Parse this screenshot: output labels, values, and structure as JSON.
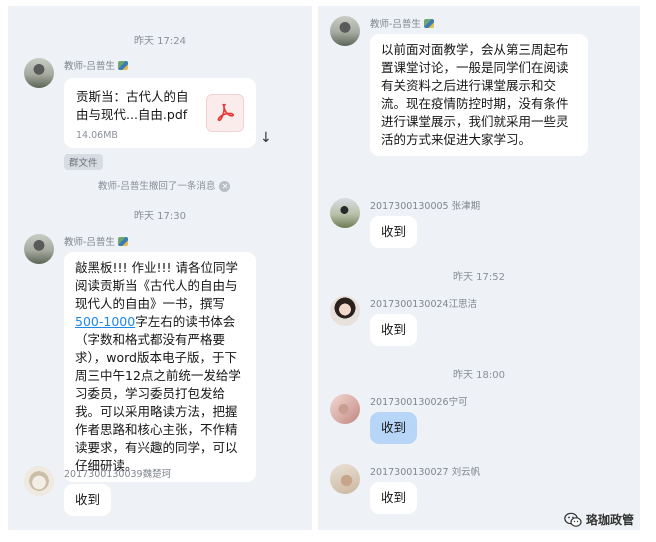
{
  "left": {
    "time1": "昨天 17:24",
    "file_msg": {
      "sender": "教师-吕普生",
      "file_name": "贡斯当：古代人的自由与现代...自由.pdf",
      "file_size": "14.06MB",
      "origin_chip": "群文件"
    },
    "recall_note": "教师-吕普生撤回了一条消息",
    "time2": "昨天 17:30",
    "assign_msg": {
      "sender": "教师-吕普生",
      "part1": "敲黑板!!! 作业!!! 请各位同学阅读贡斯当《古代人的自由与现代人的自由》一书，撰写",
      "link": "500-1000",
      "part2": "字左右的读书体会（字数和格式都没有严格要求），word版本电子版，于下周三中午12点之前统一发给学习委员，学习委员打包发给我。可以采用略读方法，把握作者思路和核心主张，不作精读要求，有兴趣的同学，可以仔细研读。"
    },
    "reply1": {
      "sender": "2017300130039魏楚珂",
      "text": "收到"
    }
  },
  "right": {
    "teacher_msg": {
      "sender": "教师-吕普生",
      "text": "以前面对面教学，会从第三周起布置课堂讨论，一般是同学们在阅读有关资料之后进行课堂展示和交流。现在疫情防控时期，没有条件进行课堂展示，我们就采用一些灵活的方式来促进大家学习。"
    },
    "reply1": {
      "sender": "2017300130005 张津期",
      "text": "收到"
    },
    "time1": "昨天 17:52",
    "reply2": {
      "sender": "2017300130024江思洁",
      "text": "收到"
    },
    "time2": "昨天 18:00",
    "reply3": {
      "sender": "2017300130026宁可",
      "text": "收到"
    },
    "reply4": {
      "sender": "2017300130027 刘云帆",
      "text": "收到"
    }
  },
  "watermark": {
    "icon": "wechat-icon",
    "text": "珞珈政管"
  },
  "colors": {
    "panel_bg": "#eef1f6",
    "bubble_white": "#ffffff",
    "bubble_blue": "#b7d6f7",
    "link": "#1e88e5",
    "pdf_red": "#e53935"
  }
}
